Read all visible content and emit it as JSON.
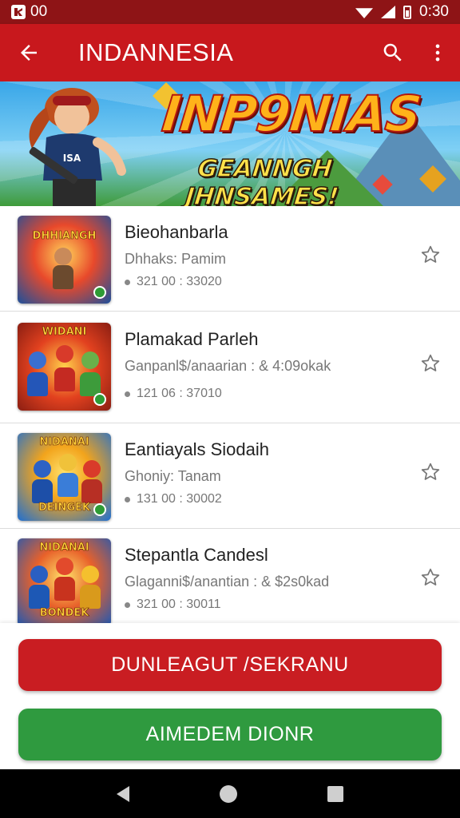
{
  "status_bar": {
    "left_text": "00",
    "time": "0:30"
  },
  "app_bar": {
    "title": "INDANNESIA",
    "back_icon": "arrow-left-icon",
    "search_icon": "search-icon",
    "menu_icon": "more-vert-icon"
  },
  "banner": {
    "title": "INP9NIAS",
    "subtitle": "GEANNGH JHNSAMES!"
  },
  "items": [
    {
      "title": "Bieohanbarla",
      "subtitle": "Dhhaks: Pamim",
      "meta": "321 00 : 33020",
      "thumb_caption": "DHHIANGH",
      "colors": [
        "#e8492b",
        "#1b4f9c",
        "#f0a020"
      ]
    },
    {
      "title": "Plamakad Parleh",
      "subtitle": "Ganpanl$/anaarian : & 4:09okak",
      "meta": "121 06 : 37010",
      "thumb_caption": "WIDANI",
      "colors": [
        "#e2411f",
        "#2456b8",
        "#3d9b3b"
      ]
    },
    {
      "title": "Eantiayals Siodaih",
      "subtitle": "Ghoniy: Tanam",
      "meta": "131 00 : 30002",
      "thumb_caption": "NIDANAI",
      "bottom_caption": "DEINGEK",
      "colors": [
        "#1f6fd1",
        "#f2a41c",
        "#d93a2a"
      ]
    },
    {
      "title": "Stepantla Candesl",
      "subtitle": "Glaganni$/anantian : & $2s0kad",
      "meta": "321 00 : 30011",
      "thumb_caption": "NIDANAI",
      "bottom_caption": "BONDEK",
      "colors": [
        "#e8612a",
        "#1d58b5",
        "#f4c02e"
      ]
    }
  ],
  "buttons": {
    "primary_label": "DUNLEAGUT /SEKRANU",
    "secondary_label": "AIMEDEM DIONR",
    "primary_color": "#c91d22",
    "secondary_color": "#2f9a3f"
  },
  "nav": {
    "back_icon": "nav-back-icon",
    "home_icon": "nav-home-icon",
    "recent_icon": "nav-recents-icon"
  }
}
